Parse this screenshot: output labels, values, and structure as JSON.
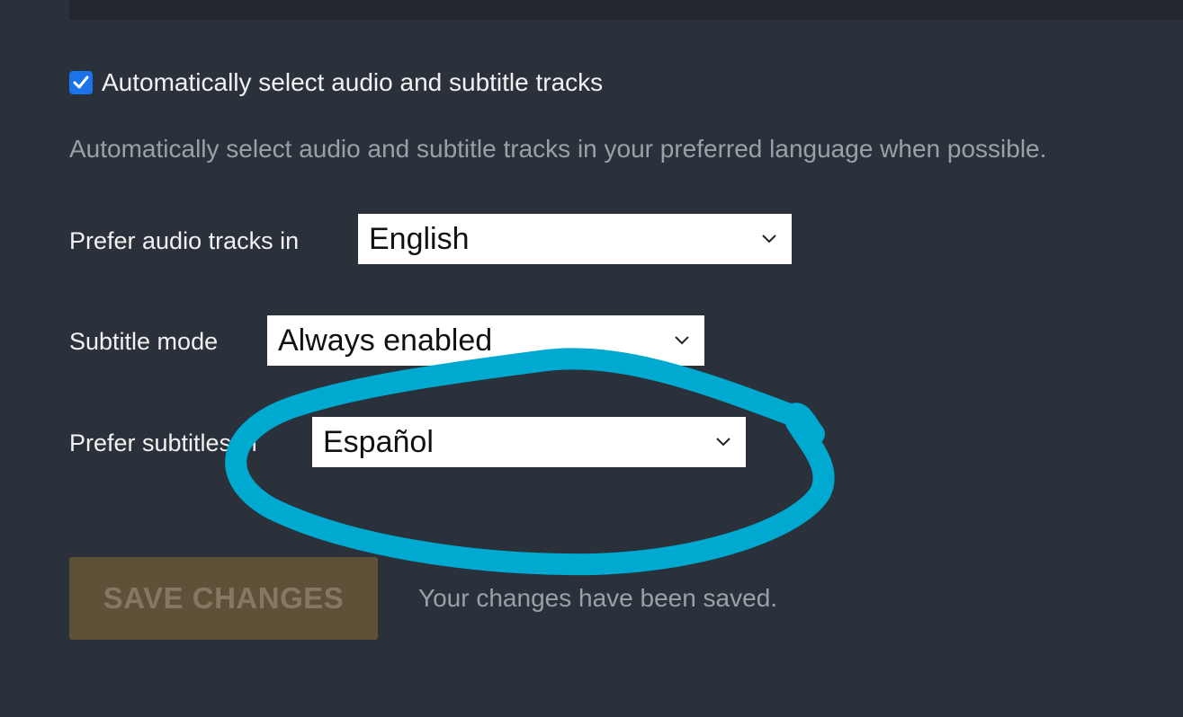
{
  "settings": {
    "auto_select": {
      "checked": true,
      "label": "Automatically select audio and subtitle tracks",
      "description": "Automatically select audio and subtitle tracks in your preferred language when possible."
    },
    "audio_language": {
      "label": "Prefer audio tracks in",
      "value": "English"
    },
    "subtitle_mode": {
      "label": "Subtitle mode",
      "value": "Always enabled"
    },
    "subtitle_language": {
      "label": "Prefer subtitles in",
      "value": "Español"
    }
  },
  "actions": {
    "save_label": "SAVE CHANGES",
    "status_text": "Your changes have been saved."
  },
  "colors": {
    "background": "#2a313b",
    "checkbox": "#1a73e8",
    "button_bg": "#5f5138",
    "annotation": "#00a9cf"
  },
  "icons": {
    "checkbox": "check-icon",
    "dropdown": "chevron-down-icon"
  }
}
